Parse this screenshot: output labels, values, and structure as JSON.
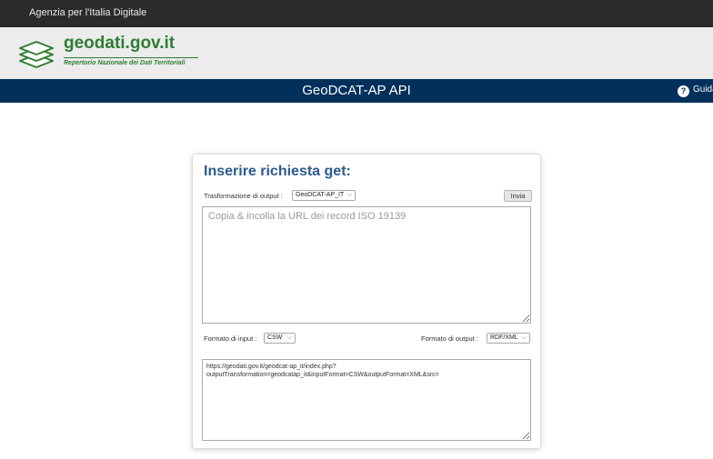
{
  "topbar": {
    "org_link": "Agenzia per l'Italia Digitale"
  },
  "brand": {
    "name": "geodati.gov.it",
    "subtitle": "Repertorio Nazionale dei Dati Territoriali"
  },
  "header": {
    "title": "GeoDCAT-AP API",
    "guide_link": "Guida"
  },
  "form": {
    "title": "Inserire richiesta get:",
    "output_transformation": {
      "label": "Trasformazione di output :",
      "selected": "GeoDCAT-AP_IT"
    },
    "submit_label": "Invia",
    "url_input": {
      "placeholder": "Copia & incolla la URL dei record ISO 19139",
      "value": ""
    },
    "input_format": {
      "label": "Formato di input :",
      "selected": "CSW"
    },
    "output_format": {
      "label": "Formato di output :",
      "selected": "RDF/XML"
    },
    "generated_url": "https://geodati.gov.it/geodcat-ap_it/index.php?outputTransformation=geodcatap_it&inputFormat=CSW&outputFormat=XML&src="
  },
  "colors": {
    "topbar": "#2b2b2b",
    "brand_green": "#2f7d32",
    "header_blue": "#00305b",
    "title_blue": "#2a5b8c"
  }
}
